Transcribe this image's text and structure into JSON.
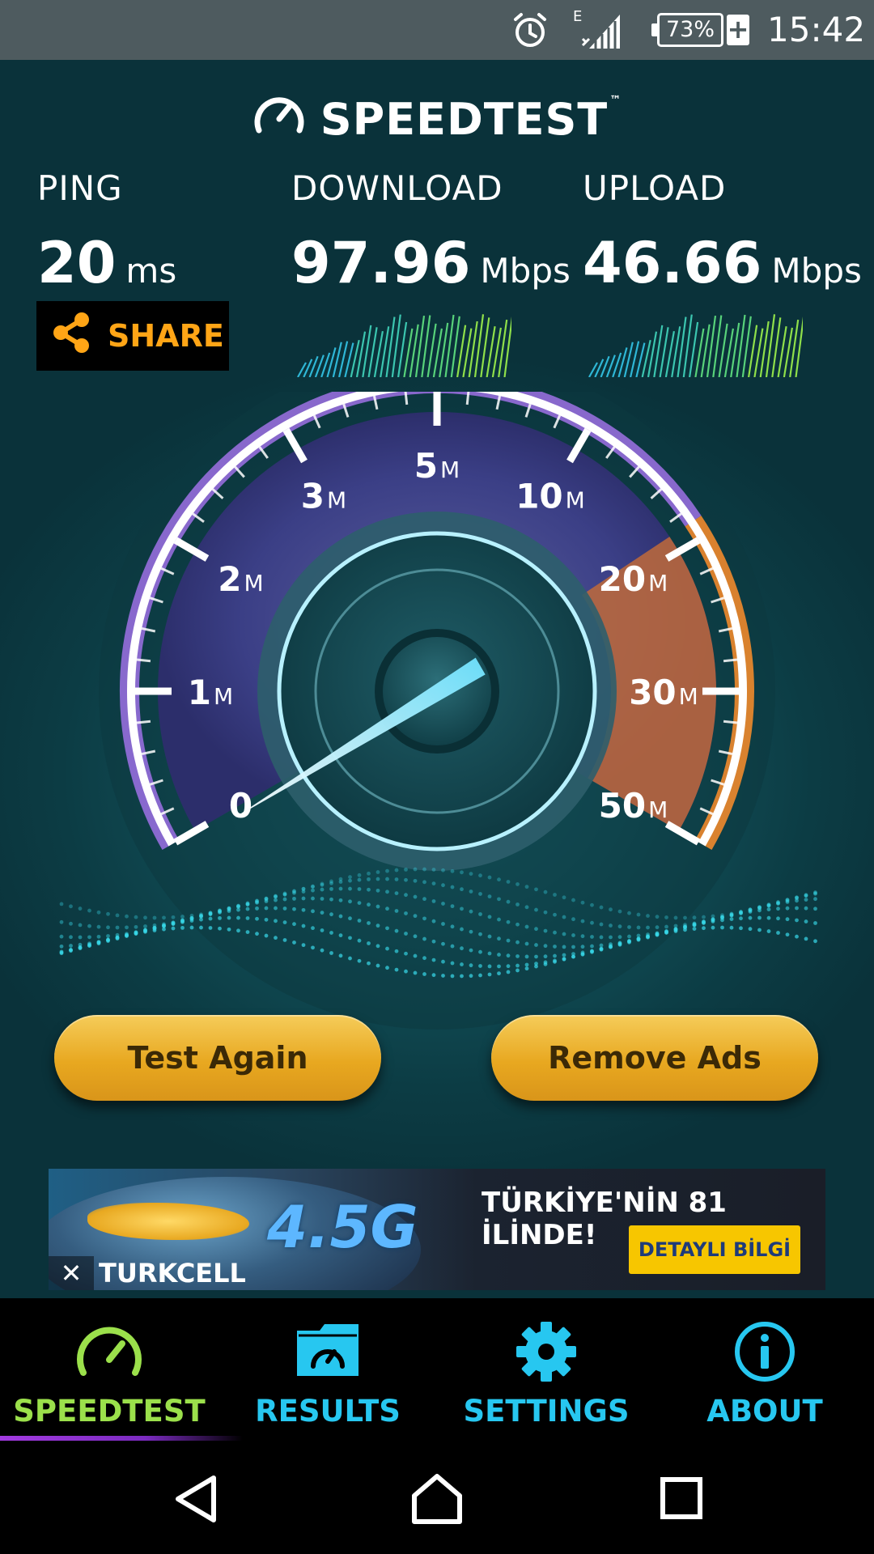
{
  "status_bar": {
    "time": "15:42",
    "battery_percent": "73%",
    "network_type": "E",
    "icons": [
      "alarm-icon",
      "signal-icon",
      "battery-icon",
      "charging-icon"
    ]
  },
  "brand": {
    "name": "SPEEDTEST",
    "trademark": "™"
  },
  "metrics": {
    "ping": {
      "label": "PING",
      "value": "20",
      "unit": "ms"
    },
    "download": {
      "label": "DOWNLOAD",
      "value": "97.96",
      "unit": "Mbps"
    },
    "upload": {
      "label": "UPLOAD",
      "value": "46.66",
      "unit": "Mbps"
    }
  },
  "share": {
    "label": "SHARE",
    "icon": "share-icon"
  },
  "gauge": {
    "scale_labels": [
      {
        "num": "0",
        "unit": ""
      },
      {
        "num": "1",
        "unit": "M"
      },
      {
        "num": "2",
        "unit": "M"
      },
      {
        "num": "3",
        "unit": "M"
      },
      {
        "num": "5",
        "unit": "M"
      },
      {
        "num": "10",
        "unit": "M"
      },
      {
        "num": "20",
        "unit": "M"
      },
      {
        "num": "30",
        "unit": "M"
      },
      {
        "num": "50",
        "unit": "M"
      }
    ],
    "needle_fraction": 0.0,
    "colors": {
      "arc_purple": "#9b59d8",
      "arc_orange": "#f08a2c",
      "needle": "#6fe3ff"
    }
  },
  "buttons": {
    "test_again": "Test Again",
    "remove_ads": "Remove Ads"
  },
  "ad": {
    "logo_text": "4.5G",
    "headline": "TÜRKİYE'NİN 81 İLİNDE!",
    "cta": "DETAYLI BİLGİ",
    "brand": "TURKCELL",
    "close_symbol": "✕"
  },
  "tabs": [
    {
      "label": "SPEEDTEST",
      "icon": "speedometer-icon",
      "active": true
    },
    {
      "label": "RESULTS",
      "icon": "results-folder-icon",
      "active": false
    },
    {
      "label": "SETTINGS",
      "icon": "gear-icon",
      "active": false
    },
    {
      "label": "ABOUT",
      "icon": "info-icon",
      "active": false
    }
  ],
  "nav": [
    "back-icon",
    "home-icon",
    "recents-icon"
  ],
  "colors": {
    "accent_orange": "#ffa516",
    "tab_blue": "#27c7f0",
    "tab_active_green": "#9be04b",
    "button_gold": "#e8a820"
  }
}
